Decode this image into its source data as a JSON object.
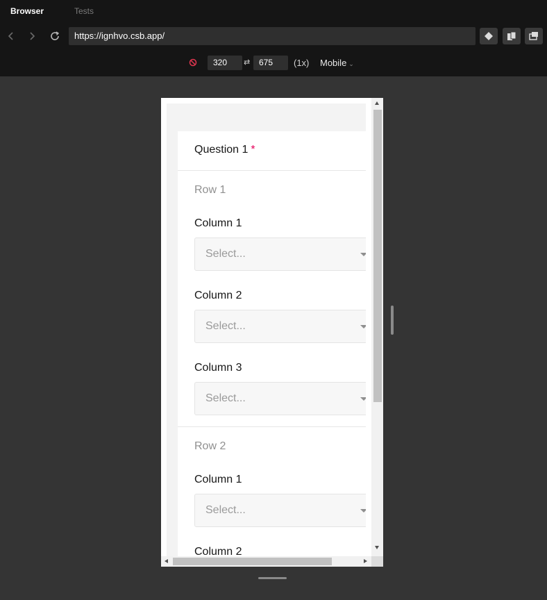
{
  "tabs": {
    "browser": "Browser",
    "tests": "Tests"
  },
  "address": {
    "url": "https://ignhvo.csb.app/"
  },
  "icons": {
    "back": "chevron-left-icon",
    "forward": "chevron-right-icon",
    "reload": "reload-icon",
    "block": "block-icon",
    "swap": "swap-icon"
  },
  "device": {
    "width": "320",
    "height": "675",
    "swap_symbol": "⇄",
    "scale": "(1x)",
    "preset": "Mobile",
    "preset_caret": "⌄"
  },
  "form": {
    "question": "Question 1",
    "required": "*",
    "rows": [
      {
        "title": "Row 1",
        "columns": [
          {
            "label": "Column 1",
            "placeholder": "Select..."
          },
          {
            "label": "Column 2",
            "placeholder": "Select..."
          },
          {
            "label": "Column 3",
            "placeholder": "Select..."
          }
        ]
      },
      {
        "title": "Row 2",
        "columns": [
          {
            "label": "Column 1",
            "placeholder": "Select..."
          },
          {
            "label": "Column 2"
          }
        ]
      }
    ]
  },
  "colors": {
    "chrome_bg": "#151515",
    "canvas_bg": "#343434",
    "required_mark": "#e5005a"
  }
}
